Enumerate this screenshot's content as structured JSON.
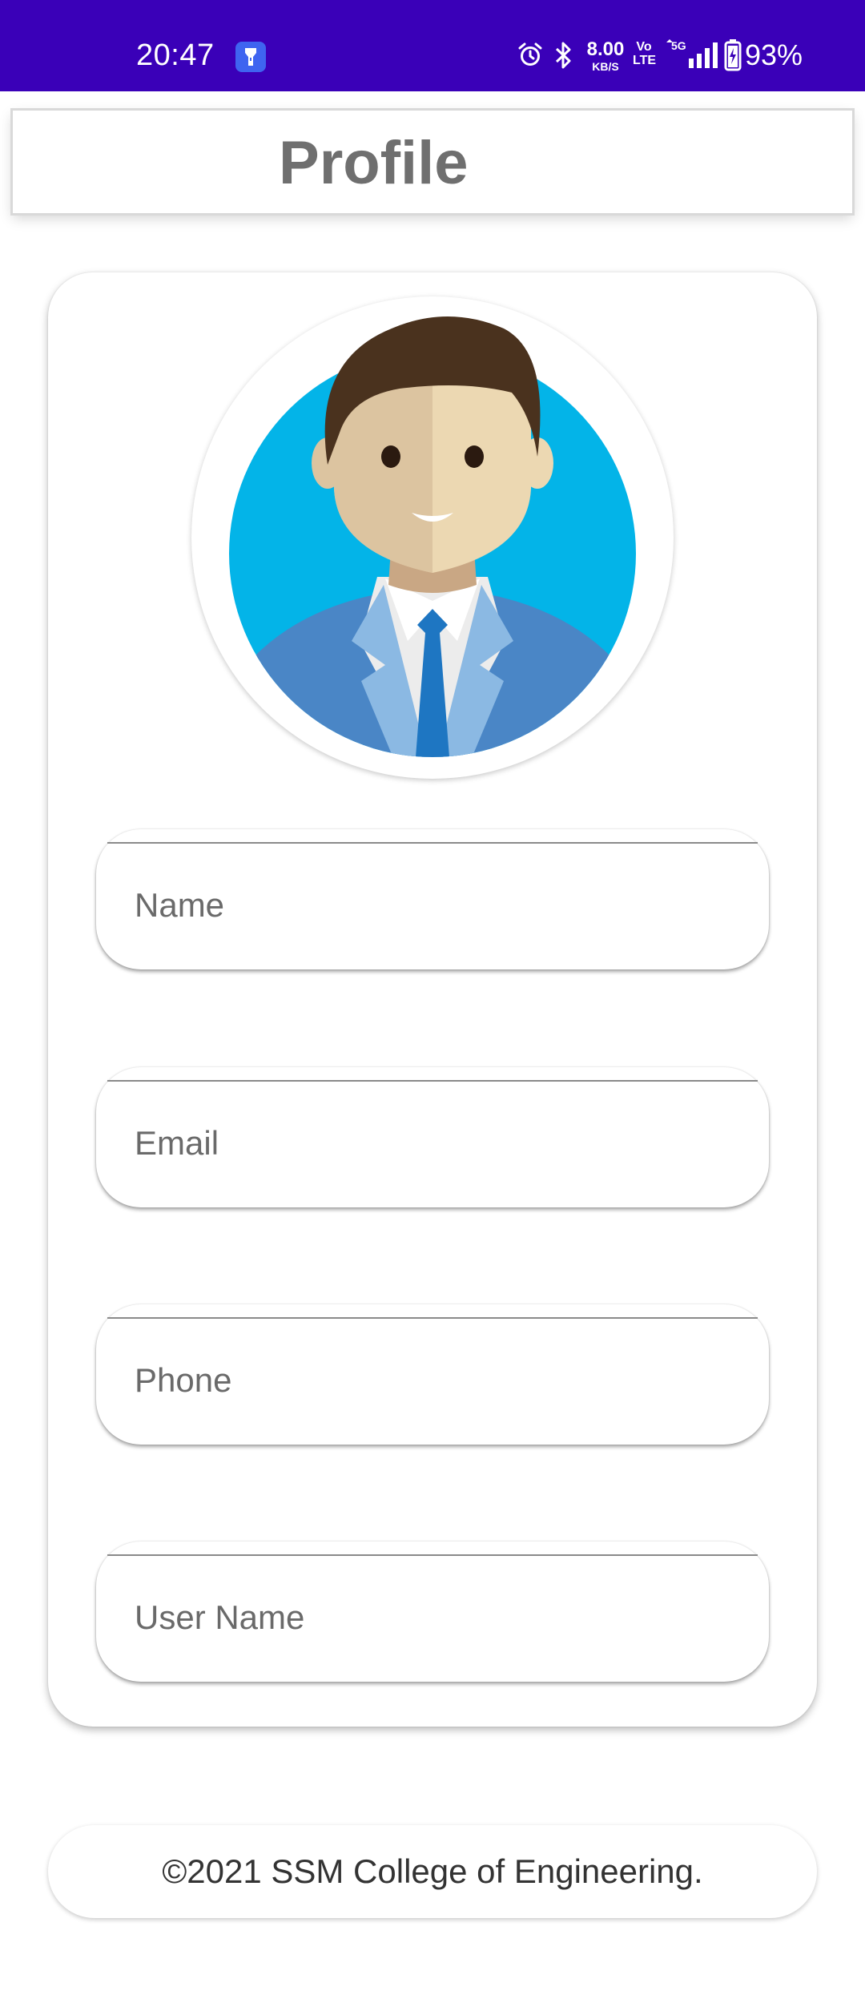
{
  "status_bar": {
    "time": "20:47",
    "speed_value": "8.00",
    "speed_unit": "KB/S",
    "volte_top": "Vo",
    "volte_bottom": "LTE",
    "network_label": "5G",
    "battery_percent": "93%",
    "background_color": "#3a00b8",
    "icons": [
      "torch-icon",
      "alarm-icon",
      "bluetooth-icon",
      "signal-icon",
      "battery-icon"
    ]
  },
  "header": {
    "title": "Profile"
  },
  "profile": {
    "avatar_icon": "user-avatar-icon",
    "fields": [
      {
        "name": "name",
        "placeholder": "Name",
        "value": ""
      },
      {
        "name": "email",
        "placeholder": "Email",
        "value": ""
      },
      {
        "name": "phone",
        "placeholder": "Phone",
        "value": ""
      },
      {
        "name": "username",
        "placeholder": "User Name",
        "value": ""
      }
    ]
  },
  "footer": {
    "copyright": "©2021 SSM College of Engineering."
  }
}
